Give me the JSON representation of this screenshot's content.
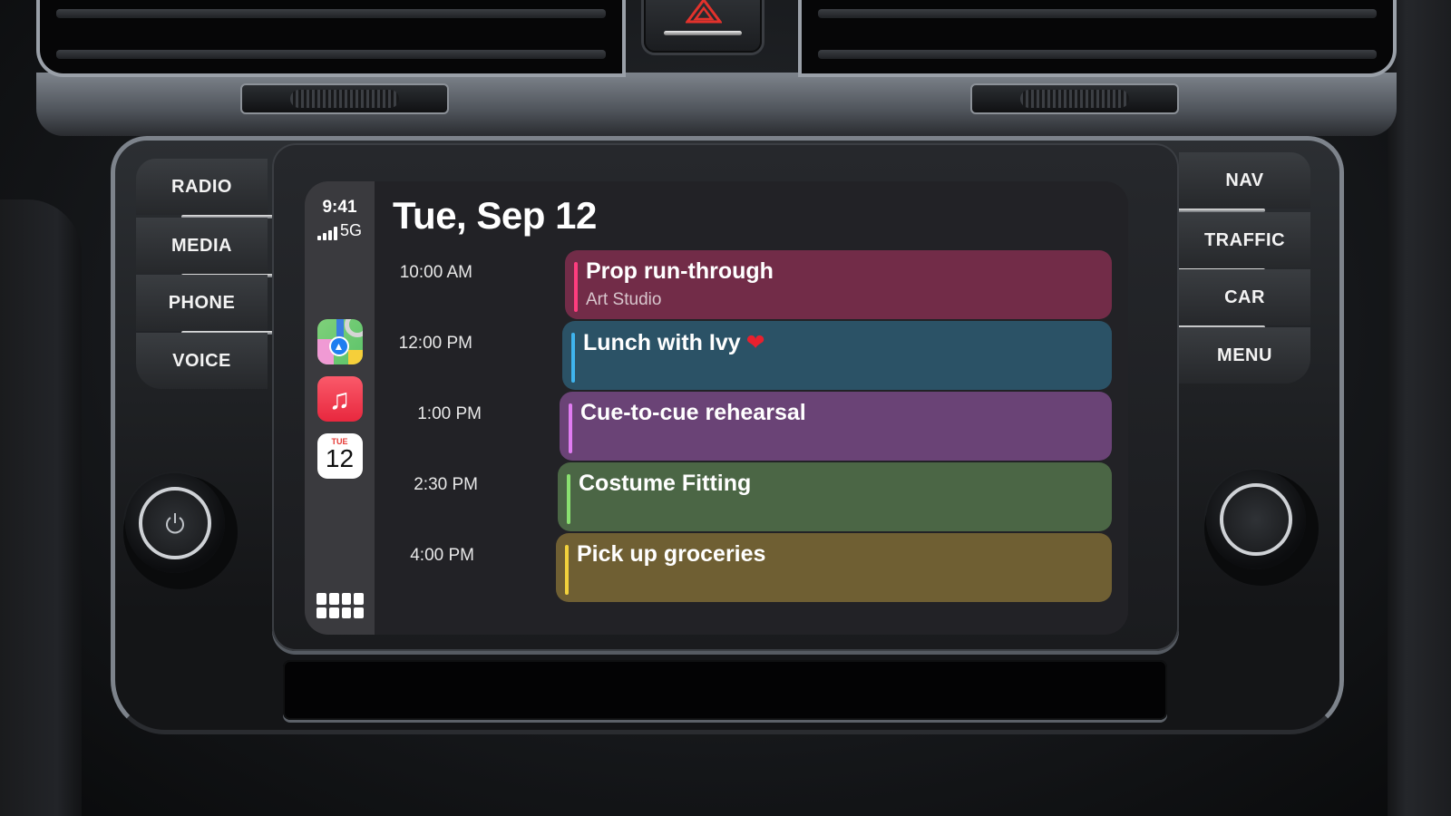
{
  "dashboard": {
    "hazard_icon": "hazard-triangle-icon",
    "left_buttons": [
      {
        "label": "RADIO"
      },
      {
        "label": "MEDIA"
      },
      {
        "label": "PHONE"
      },
      {
        "label": "VOICE"
      }
    ],
    "right_buttons": [
      {
        "label": "NAV"
      },
      {
        "label": "TRAFFIC"
      },
      {
        "label": "CAR"
      },
      {
        "label": "MENU"
      }
    ],
    "power_knob_icon": "power-icon",
    "colors": {
      "hazard": "#e2322c"
    }
  },
  "carplay": {
    "status": {
      "time": "9:41",
      "network": "5G",
      "signal_bars": 4
    },
    "dock": [
      {
        "name": "Maps",
        "icon": "maps-icon"
      },
      {
        "name": "Music",
        "icon": "music-note-icon",
        "glyph": "♫"
      },
      {
        "name": "Calendar",
        "icon": "calendar-icon",
        "weekday": "TUE",
        "day": "12"
      }
    ],
    "app_grid_icon": "app-grid-icon",
    "calendar": {
      "date_title": "Tue, Sep 12",
      "events": [
        {
          "time": "10:00 AM",
          "title": "Prop run-through",
          "location": "Art Studio",
          "color": "#722c48",
          "accent": "#ff3d7f"
        },
        {
          "time": "12:00 PM",
          "title": "Lunch with Ivy",
          "emoji": "❤",
          "color": "#2b5266",
          "accent": "#3fb4ee"
        },
        {
          "time": "1:00 PM",
          "title": "Cue-to-cue rehearsal",
          "color": "#6a4376",
          "accent": "#e07cf2"
        },
        {
          "time": "2:30 PM",
          "title": "Costume Fitting",
          "color": "#4b6645",
          "accent": "#8ae070"
        },
        {
          "time": "4:00 PM",
          "title": "Pick up groceries",
          "color": "#6f5f33",
          "accent": "#f2d23c"
        }
      ]
    }
  }
}
